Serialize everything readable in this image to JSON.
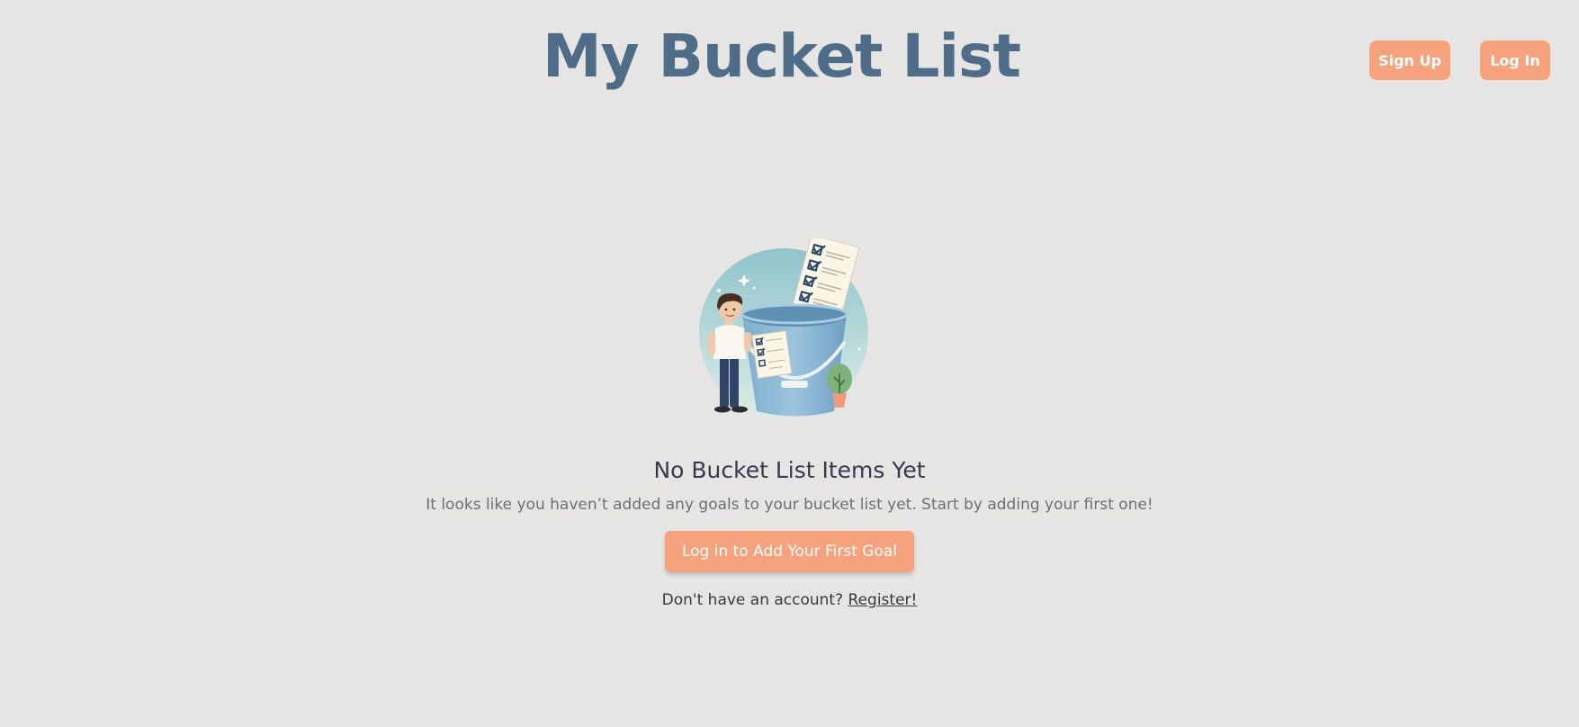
{
  "header": {
    "title": "My Bucket List",
    "signup_label": "Sign Up",
    "login_label": "Log In"
  },
  "empty_state": {
    "illustration": "person-with-bucket-checklist-illustration",
    "title": "No Bucket List Items Yet",
    "description": "It looks like you haven’t added any goals to your bucket list yet. Start by adding your first one!",
    "cta_label": "Log in to Add Your First Goal",
    "register_prompt": "Don't have an account?",
    "register_link": "Register!"
  },
  "colors": {
    "background": "#e6e5e4",
    "title": "#4f6d88",
    "accent": "#f6a27c",
    "heading": "#353b4f",
    "muted_text": "#6e6f75"
  }
}
